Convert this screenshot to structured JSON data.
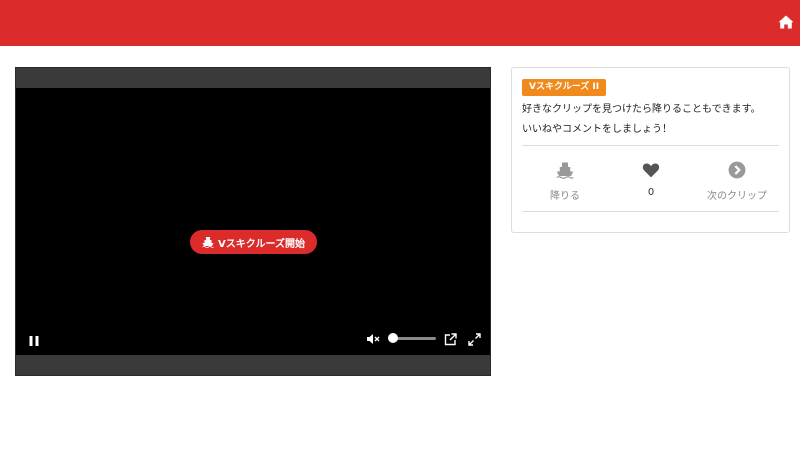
{
  "header": {
    "home_icon": "home-icon",
    "bar_color": "#dc2b2b"
  },
  "player": {
    "start_button_label": "Vスキクルーズ開始",
    "start_icon": "ship-icon",
    "controls": {
      "pause_icon": "pause-icon",
      "mute_icon": "volume-mute-icon",
      "volume_level": 0,
      "popout_icon": "external-link-icon",
      "fullscreen_icon": "fullscreen-icon"
    }
  },
  "sidebar": {
    "badge": "Vスキクルーズ II",
    "badge_color": "#f08a1c",
    "description_line1": "好きなクリップを見つけたら降りることもできます。",
    "description_line2": "いいねやコメントをしましょう！",
    "actions": {
      "get_off": {
        "label": "降りる",
        "icon": "ship-icon"
      },
      "like": {
        "count": "0",
        "icon": "heart-icon"
      },
      "next": {
        "label": "次のクリップ",
        "icon": "chevron-circle-right-icon"
      }
    }
  }
}
